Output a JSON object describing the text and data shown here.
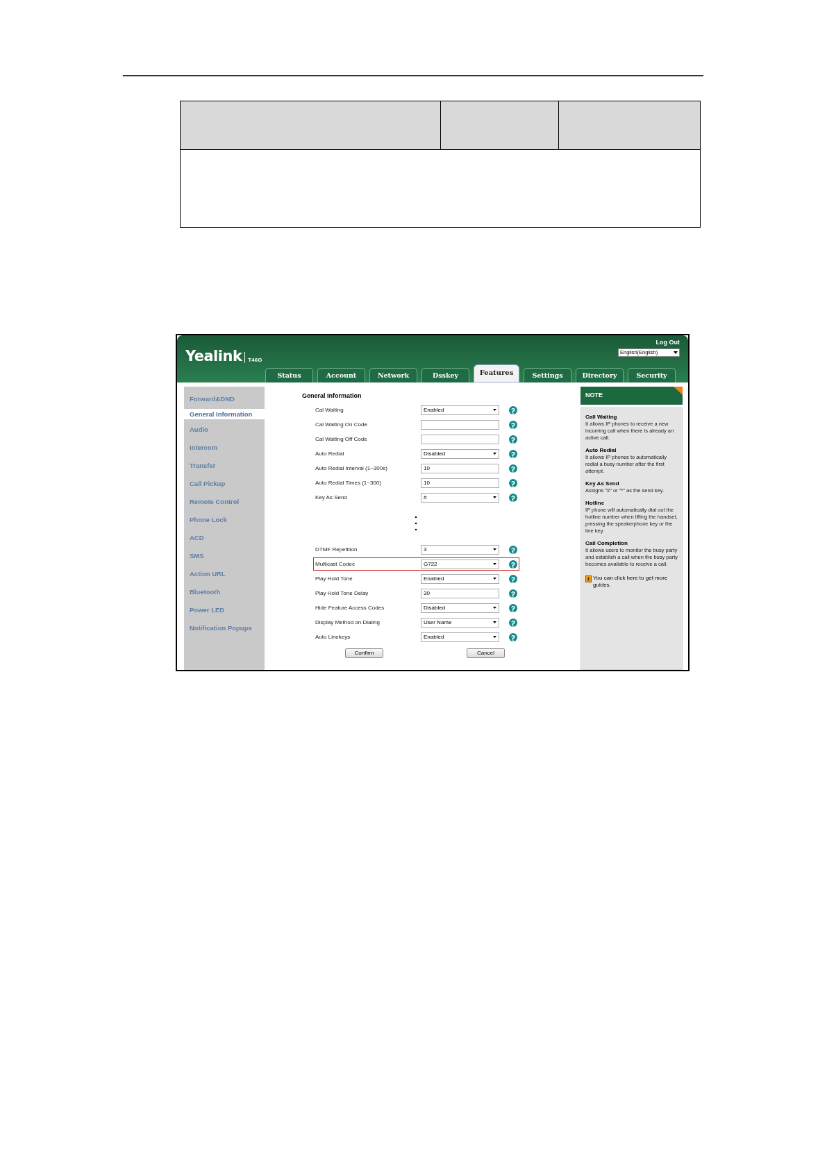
{
  "header": {
    "logo": "Yealink",
    "model": "T46G",
    "logout": "Log Out",
    "language": "English(English)"
  },
  "tabs": [
    {
      "label": "Status",
      "selected": false
    },
    {
      "label": "Account",
      "selected": false
    },
    {
      "label": "Network",
      "selected": false
    },
    {
      "label": "Dsskey",
      "selected": false
    },
    {
      "label": "Features",
      "selected": true
    },
    {
      "label": "Settings",
      "selected": false
    },
    {
      "label": "Directory",
      "selected": false
    },
    {
      "label": "Security",
      "selected": false
    }
  ],
  "sidebar": {
    "items": [
      {
        "label": "Forward&DND",
        "selected": false
      },
      {
        "label": "General Information",
        "selected": true
      },
      {
        "label": "Audio",
        "selected": false
      },
      {
        "label": "Intercom",
        "selected": false
      },
      {
        "label": "Transfer",
        "selected": false
      },
      {
        "label": "Call Pickup",
        "selected": false
      },
      {
        "label": "Remote Control",
        "selected": false
      },
      {
        "label": "Phone Lock",
        "selected": false
      },
      {
        "label": "ACD",
        "selected": false
      },
      {
        "label": "SMS",
        "selected": false
      },
      {
        "label": "Action URL",
        "selected": false
      },
      {
        "label": "Bluetooth",
        "selected": false
      },
      {
        "label": "Power LED",
        "selected": false
      },
      {
        "label": "Notification Popups",
        "selected": false
      }
    ]
  },
  "form": {
    "title": "General Information",
    "fields": [
      {
        "kind": "select",
        "label": "Cal Waiting",
        "value": "Enabled",
        "highlighted": false
      },
      {
        "kind": "text",
        "label": "Cal Waiting On Code",
        "highlighted": false
      },
      {
        "kind": "text",
        "label": "Cal Waiting Off Code",
        "highlighted": false
      },
      {
        "kind": "select",
        "label": "Auto Redial",
        "value": "Disabled",
        "highlighted": false
      },
      {
        "kind": "text",
        "label": "Auto Redial Interval (1~300s)",
        "value": "10",
        "highlighted": false
      },
      {
        "kind": "text",
        "label": "Auto Redial Times (1~300)",
        "value": "10",
        "highlighted": false
      },
      {
        "kind": "select",
        "label": "Key As Send",
        "value": "#",
        "highlighted": false
      },
      {
        "kind": "gap"
      },
      {
        "kind": "select",
        "label": "DTMF Repetition",
        "value": "3",
        "highlighted": false
      },
      {
        "kind": "select",
        "label": "Multicast Codec",
        "value": "G722",
        "highlighted": true
      },
      {
        "kind": "select",
        "label": "Play Hold Tone",
        "value": "Enabled",
        "highlighted": false
      },
      {
        "kind": "text",
        "label": "Play Hold Tone Delay",
        "value": "30",
        "highlighted": false
      },
      {
        "kind": "select",
        "label": "Hide Feature Access Codes",
        "value": "Disabled",
        "highlighted": false
      },
      {
        "kind": "select",
        "label": "Display Method on Dialing",
        "value": "User Name",
        "highlighted": false
      },
      {
        "kind": "select",
        "label": "Auto Linekeys",
        "value": "Enabled",
        "highlighted": false
      }
    ],
    "buttons": [
      "Confirm",
      "Cancel"
    ]
  },
  "note": {
    "title": "NOTE",
    "entries": [
      {
        "title": "Call Waiting",
        "text": "It allows IP phones to receive a new incoming call when there is already an active call."
      },
      {
        "title": "Auto Redial",
        "text": "It allows IP phones to automatically redial a busy number after the first attempt."
      },
      {
        "title": "Key As Send",
        "text": "Assigns \"#\" or \"*\" as the send key."
      },
      {
        "title": "Hotline",
        "text": "IP phone will automatically dial out the hotline number when lifting the handset, pressing the speakerphone key or the line key."
      },
      {
        "title": "Call Completion",
        "text": "It allows users to monitor the busy party and establish a call when the busy party becomes available to receive a call."
      }
    ],
    "guide": "You can click here to get more guides."
  }
}
